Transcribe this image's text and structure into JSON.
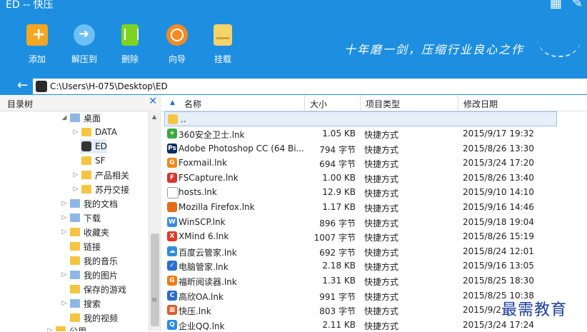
{
  "window": {
    "title": "ED -- 快压"
  },
  "toolbar": [
    {
      "label": "添加",
      "icon": "add-icon",
      "color": "#f5a623"
    },
    {
      "label": "解压到",
      "icon": "extract-icon",
      "color": "#6cc0f5"
    },
    {
      "label": "删除",
      "icon": "trash-icon",
      "color": "#7ed321"
    },
    {
      "label": "向导",
      "icon": "wizard-icon",
      "color": "#f58a23"
    },
    {
      "label": "挂载",
      "icon": "mount-icon",
      "color": "#f5d36b"
    }
  ],
  "slogan": "十年磨一剑，压缩行业良心之作",
  "address": {
    "path": "C:\\Users\\H-075\\Desktop\\ED"
  },
  "tree": {
    "header": "目录树",
    "items": [
      {
        "label": "桌面",
        "expanded": true
      },
      {
        "label": "DATA"
      },
      {
        "label": "ED",
        "selected": true
      },
      {
        "label": "SF"
      },
      {
        "label": "产品相关"
      },
      {
        "label": "苏丹交接"
      },
      {
        "label": "我的文档"
      },
      {
        "label": "下载"
      },
      {
        "label": "收藏夹"
      },
      {
        "label": "链接"
      },
      {
        "label": "我的音乐"
      },
      {
        "label": "我的图片"
      },
      {
        "label": "保存的游戏"
      },
      {
        "label": "搜索"
      },
      {
        "label": "我的视频"
      },
      {
        "label": "公用"
      }
    ]
  },
  "columns": {
    "name": "名称",
    "size": "大小",
    "type": "项目类型",
    "date": "修改日期"
  },
  "parent_row": "..",
  "files": [
    {
      "name": "360安全卫士.lnk",
      "size": "1.05 KB",
      "type": "快捷方式",
      "date": "2015/9/17 19:32",
      "icon": "360-icon",
      "color": "#3aa83a",
      "glyph": "+"
    },
    {
      "name": "Adobe Photoshop CC (64 Bi...",
      "size": "794 字节",
      "type": "快捷方式",
      "date": "2015/8/26 13:30",
      "icon": "photoshop-icon",
      "color": "#0a2f5a",
      "glyph": "Ps"
    },
    {
      "name": "Foxmail.lnk",
      "size": "694 字节",
      "type": "快捷方式",
      "date": "2015/3/24 17:20",
      "icon": "foxmail-icon",
      "color": "#f08a1c",
      "glyph": "G"
    },
    {
      "name": "FSCapture.lnk",
      "size": "1.00 KB",
      "type": "快捷方式",
      "date": "2015/8/26 13:40",
      "icon": "fscapture-icon",
      "color": "#d9332a",
      "glyph": "F"
    },
    {
      "name": "hosts.lnk",
      "size": "12.9 KB",
      "type": "快捷方式",
      "date": "2015/9/10 14:10",
      "icon": "document-icon",
      "color": "#ffffff",
      "glyph": ""
    },
    {
      "name": "Mozilla Firefox.lnk",
      "size": "1.17 KB",
      "type": "快捷方式",
      "date": "2015/9/16 14:46",
      "icon": "firefox-icon",
      "color": "#e66a1a",
      "glyph": ""
    },
    {
      "name": "WinSCP.lnk",
      "size": "896 字节",
      "type": "快捷方式",
      "date": "2015/9/18 19:04",
      "icon": "winscp-icon",
      "color": "#3a8be0",
      "glyph": "W"
    },
    {
      "name": "XMind 6.lnk",
      "size": "1007 字节",
      "type": "快捷方式",
      "date": "2015/8/26 15:19",
      "icon": "xmind-icon",
      "color": "#e03a2a",
      "glyph": "X"
    },
    {
      "name": "百度云管家.lnk",
      "size": "692 字节",
      "type": "快捷方式",
      "date": "2015/8/24 12:01",
      "icon": "baidu-cloud-icon",
      "color": "#2d8de0",
      "glyph": "☁"
    },
    {
      "name": "电脑管家.lnk",
      "size": "2.18 KB",
      "type": "快捷方式",
      "date": "2015/9/16 13:05",
      "icon": "pc-manager-icon",
      "color": "#2a70d0",
      "glyph": "✓"
    },
    {
      "name": "福昕阅读器.lnk",
      "size": "1.31 KB",
      "type": "快捷方式",
      "date": "2015/8/25 18:30",
      "icon": "foxit-icon",
      "color": "#f07a1a",
      "glyph": "G"
    },
    {
      "name": "高欣OA.lnk",
      "size": "991 字节",
      "type": "快捷方式",
      "date": "2015/8/25 10:38",
      "icon": "oa-icon",
      "color": "#2a6ad0",
      "glyph": "C"
    },
    {
      "name": "快压.lnk",
      "size": "803 字节",
      "type": "快捷方式",
      "date": "2015/9/2",
      "icon": "kuaiya-icon",
      "color": "#e05a2a",
      "glyph": "▦"
    },
    {
      "name": "企业QQ.lnk",
      "size": "2.11 KB",
      "type": "快捷方式",
      "date": "2015/3/24 17:24",
      "icon": "qq-icon",
      "color": "#2a8ae0",
      "glyph": "Q"
    }
  ],
  "watermark": "最需教育"
}
